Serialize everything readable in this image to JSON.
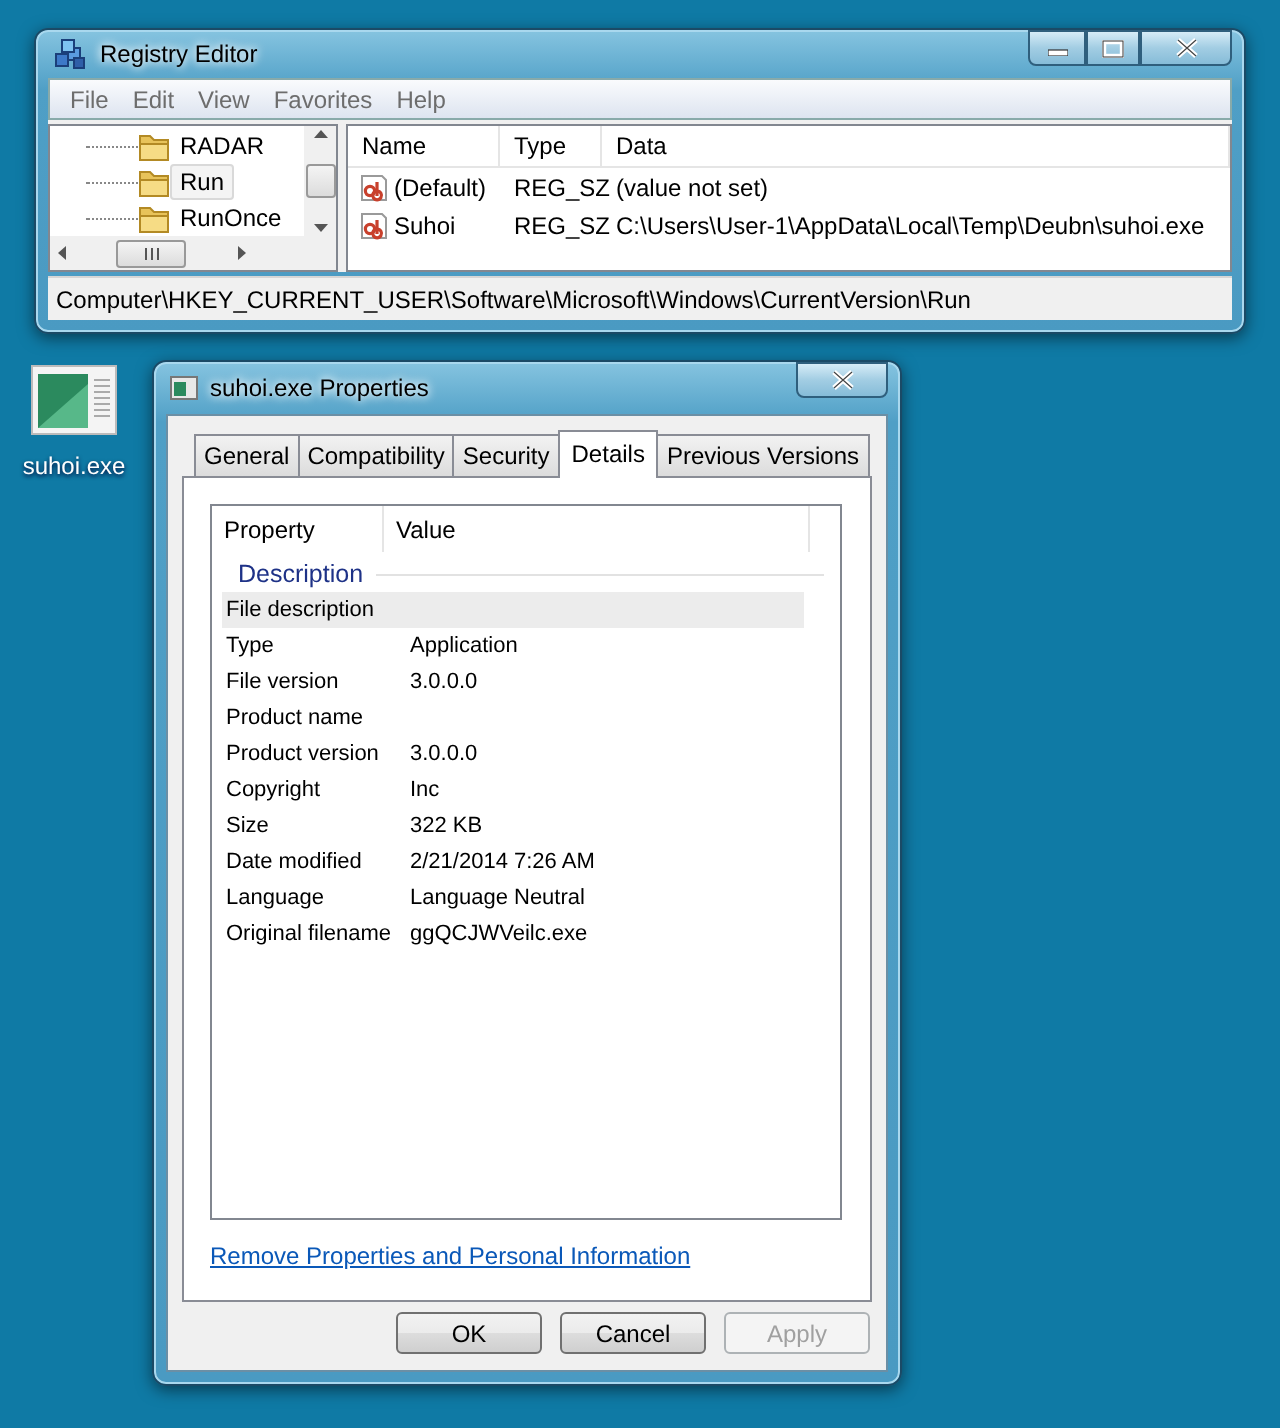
{
  "registry_editor": {
    "title": "Registry Editor",
    "menu": [
      "File",
      "Edit",
      "View",
      "Favorites",
      "Help"
    ],
    "tree": [
      {
        "label": "RADAR",
        "selected": false
      },
      {
        "label": "Run",
        "selected": true
      },
      {
        "label": "RunOnce",
        "selected": false
      }
    ],
    "columns": [
      "Name",
      "Type",
      "Data"
    ],
    "rows": [
      {
        "name": "(Default)",
        "type": "REG_SZ",
        "data": "(value not set)"
      },
      {
        "name": "Suhoi",
        "type": "REG_SZ",
        "data": "C:\\Users\\User-1\\AppData\\Local\\Temp\\Deubn\\suhoi.exe"
      }
    ],
    "status_bar": "Computer\\HKEY_CURRENT_USER\\Software\\Microsoft\\Windows\\CurrentVersion\\Run"
  },
  "desktop_icon": {
    "label": "suhoi.exe"
  },
  "properties": {
    "title": "suhoi.exe Properties",
    "tabs": [
      {
        "label": "General",
        "selected": false
      },
      {
        "label": "Compatibility",
        "selected": false
      },
      {
        "label": "Security",
        "selected": false
      },
      {
        "label": "Details",
        "selected": true
      },
      {
        "label": "Previous Versions",
        "selected": false
      }
    ],
    "columns": [
      "Property",
      "Value"
    ],
    "section": "Description",
    "rows": [
      {
        "property": "File description",
        "selected": true
      },
      {
        "property": "Type",
        "value": "Application",
        "selected": false
      },
      {
        "property": "File version",
        "value": "3.0.0.0",
        "selected": false
      },
      {
        "property": "Product name",
        "selected": false
      },
      {
        "property": "Product version",
        "value": "3.0.0.0",
        "selected": false
      },
      {
        "property": "Copyright",
        "value": "Inc",
        "selected": false
      },
      {
        "property": "Size",
        "value": "322 KB",
        "selected": false
      },
      {
        "property": "Date modified",
        "value": "2/21/2014 7:26 AM",
        "selected": false
      },
      {
        "property": "Language",
        "value": "Language Neutral",
        "selected": false
      },
      {
        "property": "Original filename",
        "value": "ggQCJWVeilc.exe",
        "selected": false
      }
    ],
    "link": "Remove Properties and Personal Information",
    "buttons": [
      {
        "label": "OK",
        "disabled": false
      },
      {
        "label": "Cancel",
        "disabled": false
      },
      {
        "label": "Apply",
        "disabled": true
      }
    ]
  }
}
